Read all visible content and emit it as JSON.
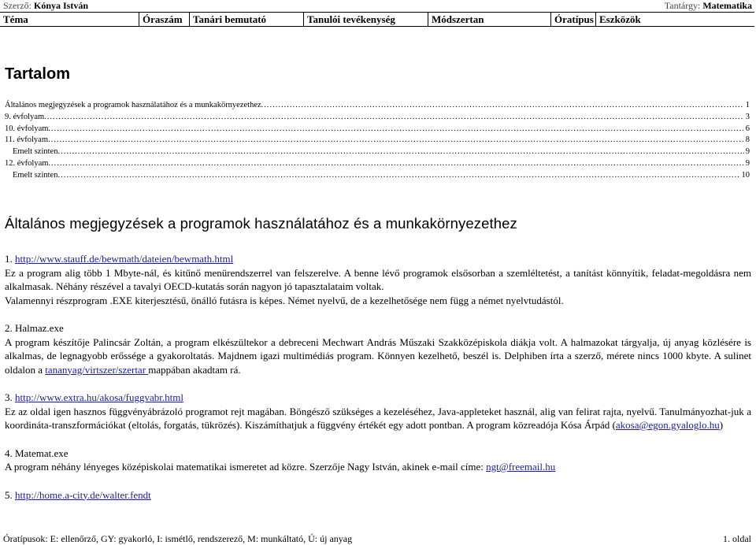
{
  "header": {
    "author_label": "Szerző:",
    "author_name": "Kónya István",
    "subject_label": "Tantárgy:",
    "subject_name": "Matematika"
  },
  "columns": [
    "Téma",
    "Óraszám",
    "Tanári bemutató",
    "Tanulói tevékenység",
    "Módszertan",
    "Óratípus",
    "Eszközök"
  ],
  "toc": {
    "title": "Tartalom",
    "items": [
      {
        "label": "Általános megjegyzések a programok használatához és a munkakörnyezethez",
        "page": "1"
      },
      {
        "label": "9. évfolyam",
        "page": "3"
      },
      {
        "label": "10. évfolyam",
        "page": "6"
      },
      {
        "label": "11. évfolyam",
        "page": "8"
      },
      {
        "label": "Emelt szinten",
        "page": "9"
      },
      {
        "label": "12. évfolyam",
        "page": "9"
      },
      {
        "label": "Emelt szinten",
        "page": "10"
      }
    ]
  },
  "section": {
    "title": "Általános megjegyzések a programok használatához és a munkakörnyezethez",
    "items": [
      {
        "num": "1.",
        "link": "http://www.stauff.de/bewmath/dateien/bewmath.html",
        "lines": [
          "Ez a program alig több 1 Mbyte-nál, és kitűnő menürendszerrel van felszerelve. A benne lévő programok elsősorban a szemléltetést, a tanítást könnyítik, feladat-megoldásra nem alkalmasak. Néhány részével a tavalyi OECD-kutatás során nagyon jó tapasztalataim voltak.",
          "Valamennyi részprogram .EXE kiterjesztésű, önálló futásra is képes. Német nyelvű, de a kezelhetősége nem függ a német nyelvtudástól."
        ]
      },
      {
        "num": "2.",
        "name": "Halmaz.exe",
        "text_before_link": "A program készítője Palincsár Zoltán, a program elkészültekor a debreceni Mechwart András Műszaki Szakközépiskola diákja volt. A halmazokat tárgyalja, új anyag közlésére is alkalmas, de legnagyobb erőssége a gyakoroltatás. Majdnem igazi multimédiás program. Könnyen kezelhető, beszél is. Delphiben írta a szerző, mérete nincs 1000 kbyte. A sulinet oldalon a ",
        "inline_link": "tananyag/virtszer/szertar ",
        "text_after_link": "mappában akadtam rá."
      },
      {
        "num": "3.",
        "link": "http://www.extra.hu/akosa/fuggvabr.html",
        "text": "Ez az oldal igen hasznos függvényábrázoló programot rejt magában. Böngésző szükséges a kezeléséhez, Java-appleteket használ, alig van felirat rajta, nyelvű. Tanulmányozhat-juk a koordináta-transzformációkat (eltolás, forgatás, tükrözés). Kiszámíthatjuk a függvény értékét egy adott pontban. A program közreadója Kósa Árpád",
        "email": "akosa@egon.gyaloglo.hu"
      },
      {
        "num": "4.",
        "name": "Matemat.exe",
        "text": "A program néhány lényeges középiskolai matematikai ismeretet ad közre. Szerzője Nagy István, akinek e-mail címe: ",
        "email": "ngt@freemail.hu"
      },
      {
        "num": "5.",
        "link": "http://home.a-city.de/walter.fendt"
      }
    ]
  },
  "footer": {
    "legend": "Óratípusok: E: ellenőrző, GY: gyakorló, I: ismétlő, rendszerező, M: munkáltató, Ú: új anyag",
    "page": "1. oldal"
  }
}
